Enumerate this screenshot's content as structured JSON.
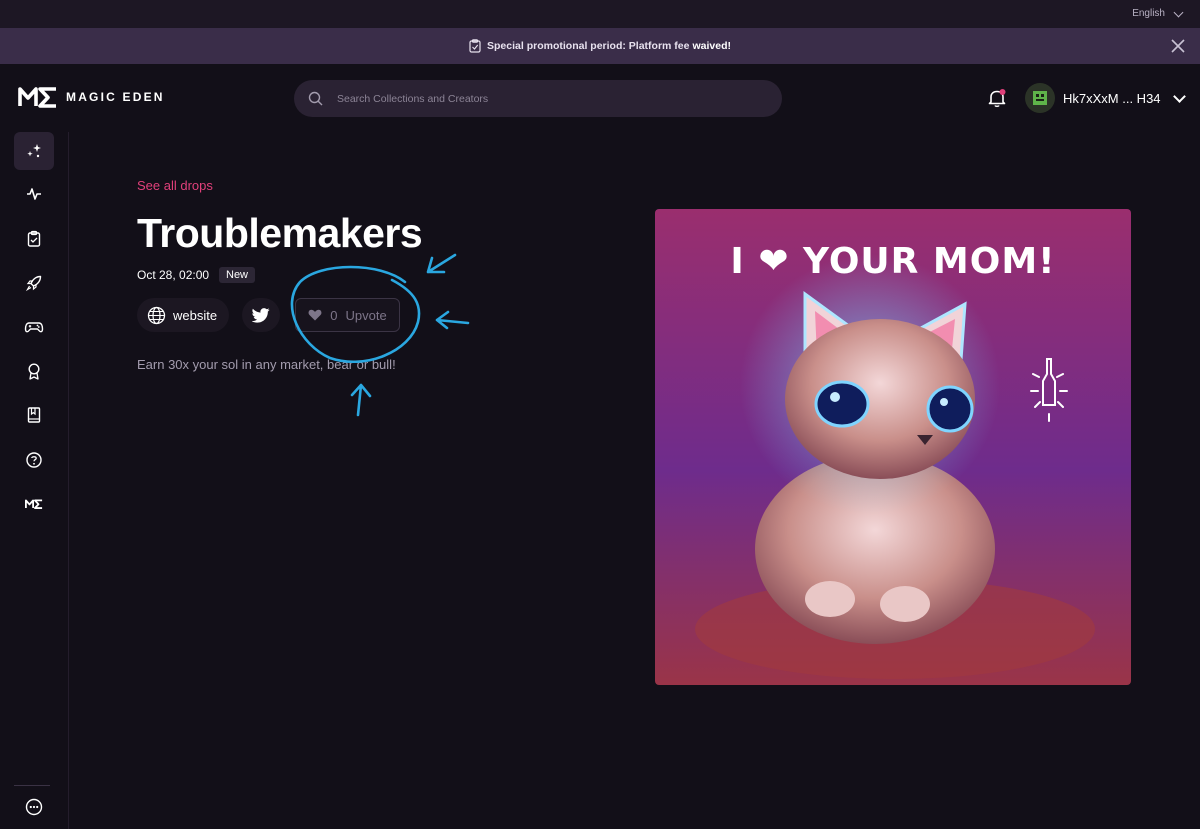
{
  "topbar": {
    "language": "English"
  },
  "promo": {
    "text": "Special promotional period: Platform fee",
    "emphasis": "waived!"
  },
  "header": {
    "logo_text": "MAGIC EDEN",
    "search_placeholder": "Search Collections and Creators",
    "user_name": "Hk7xXxM ... H34"
  },
  "sidebar": {
    "items": [
      {
        "icon": "sparkles-icon"
      },
      {
        "icon": "activity-icon"
      },
      {
        "icon": "clipboard-icon"
      },
      {
        "icon": "rocket-icon"
      },
      {
        "icon": "gamepad-icon"
      },
      {
        "icon": "award-icon"
      },
      {
        "icon": "book-icon"
      },
      {
        "icon": "help-icon"
      },
      {
        "icon": "magic-eden-icon"
      }
    ],
    "bottom_icon": "more-icon"
  },
  "drop": {
    "back_link": "See all drops",
    "title": "Troublemakers",
    "date": "Oct 28, 02:00",
    "badge": "New",
    "website_label": "website",
    "upvote_count": "0",
    "upvote_label": "Upvote",
    "description": "Earn 30x your sol in any market, bear or bull!",
    "image_text": "I ❤ YOUR MOM!"
  },
  "colors": {
    "background": "#120f18",
    "accent": "#e0407a",
    "promo_bg": "#3a2d49",
    "annotation": "#2aa7e0"
  }
}
